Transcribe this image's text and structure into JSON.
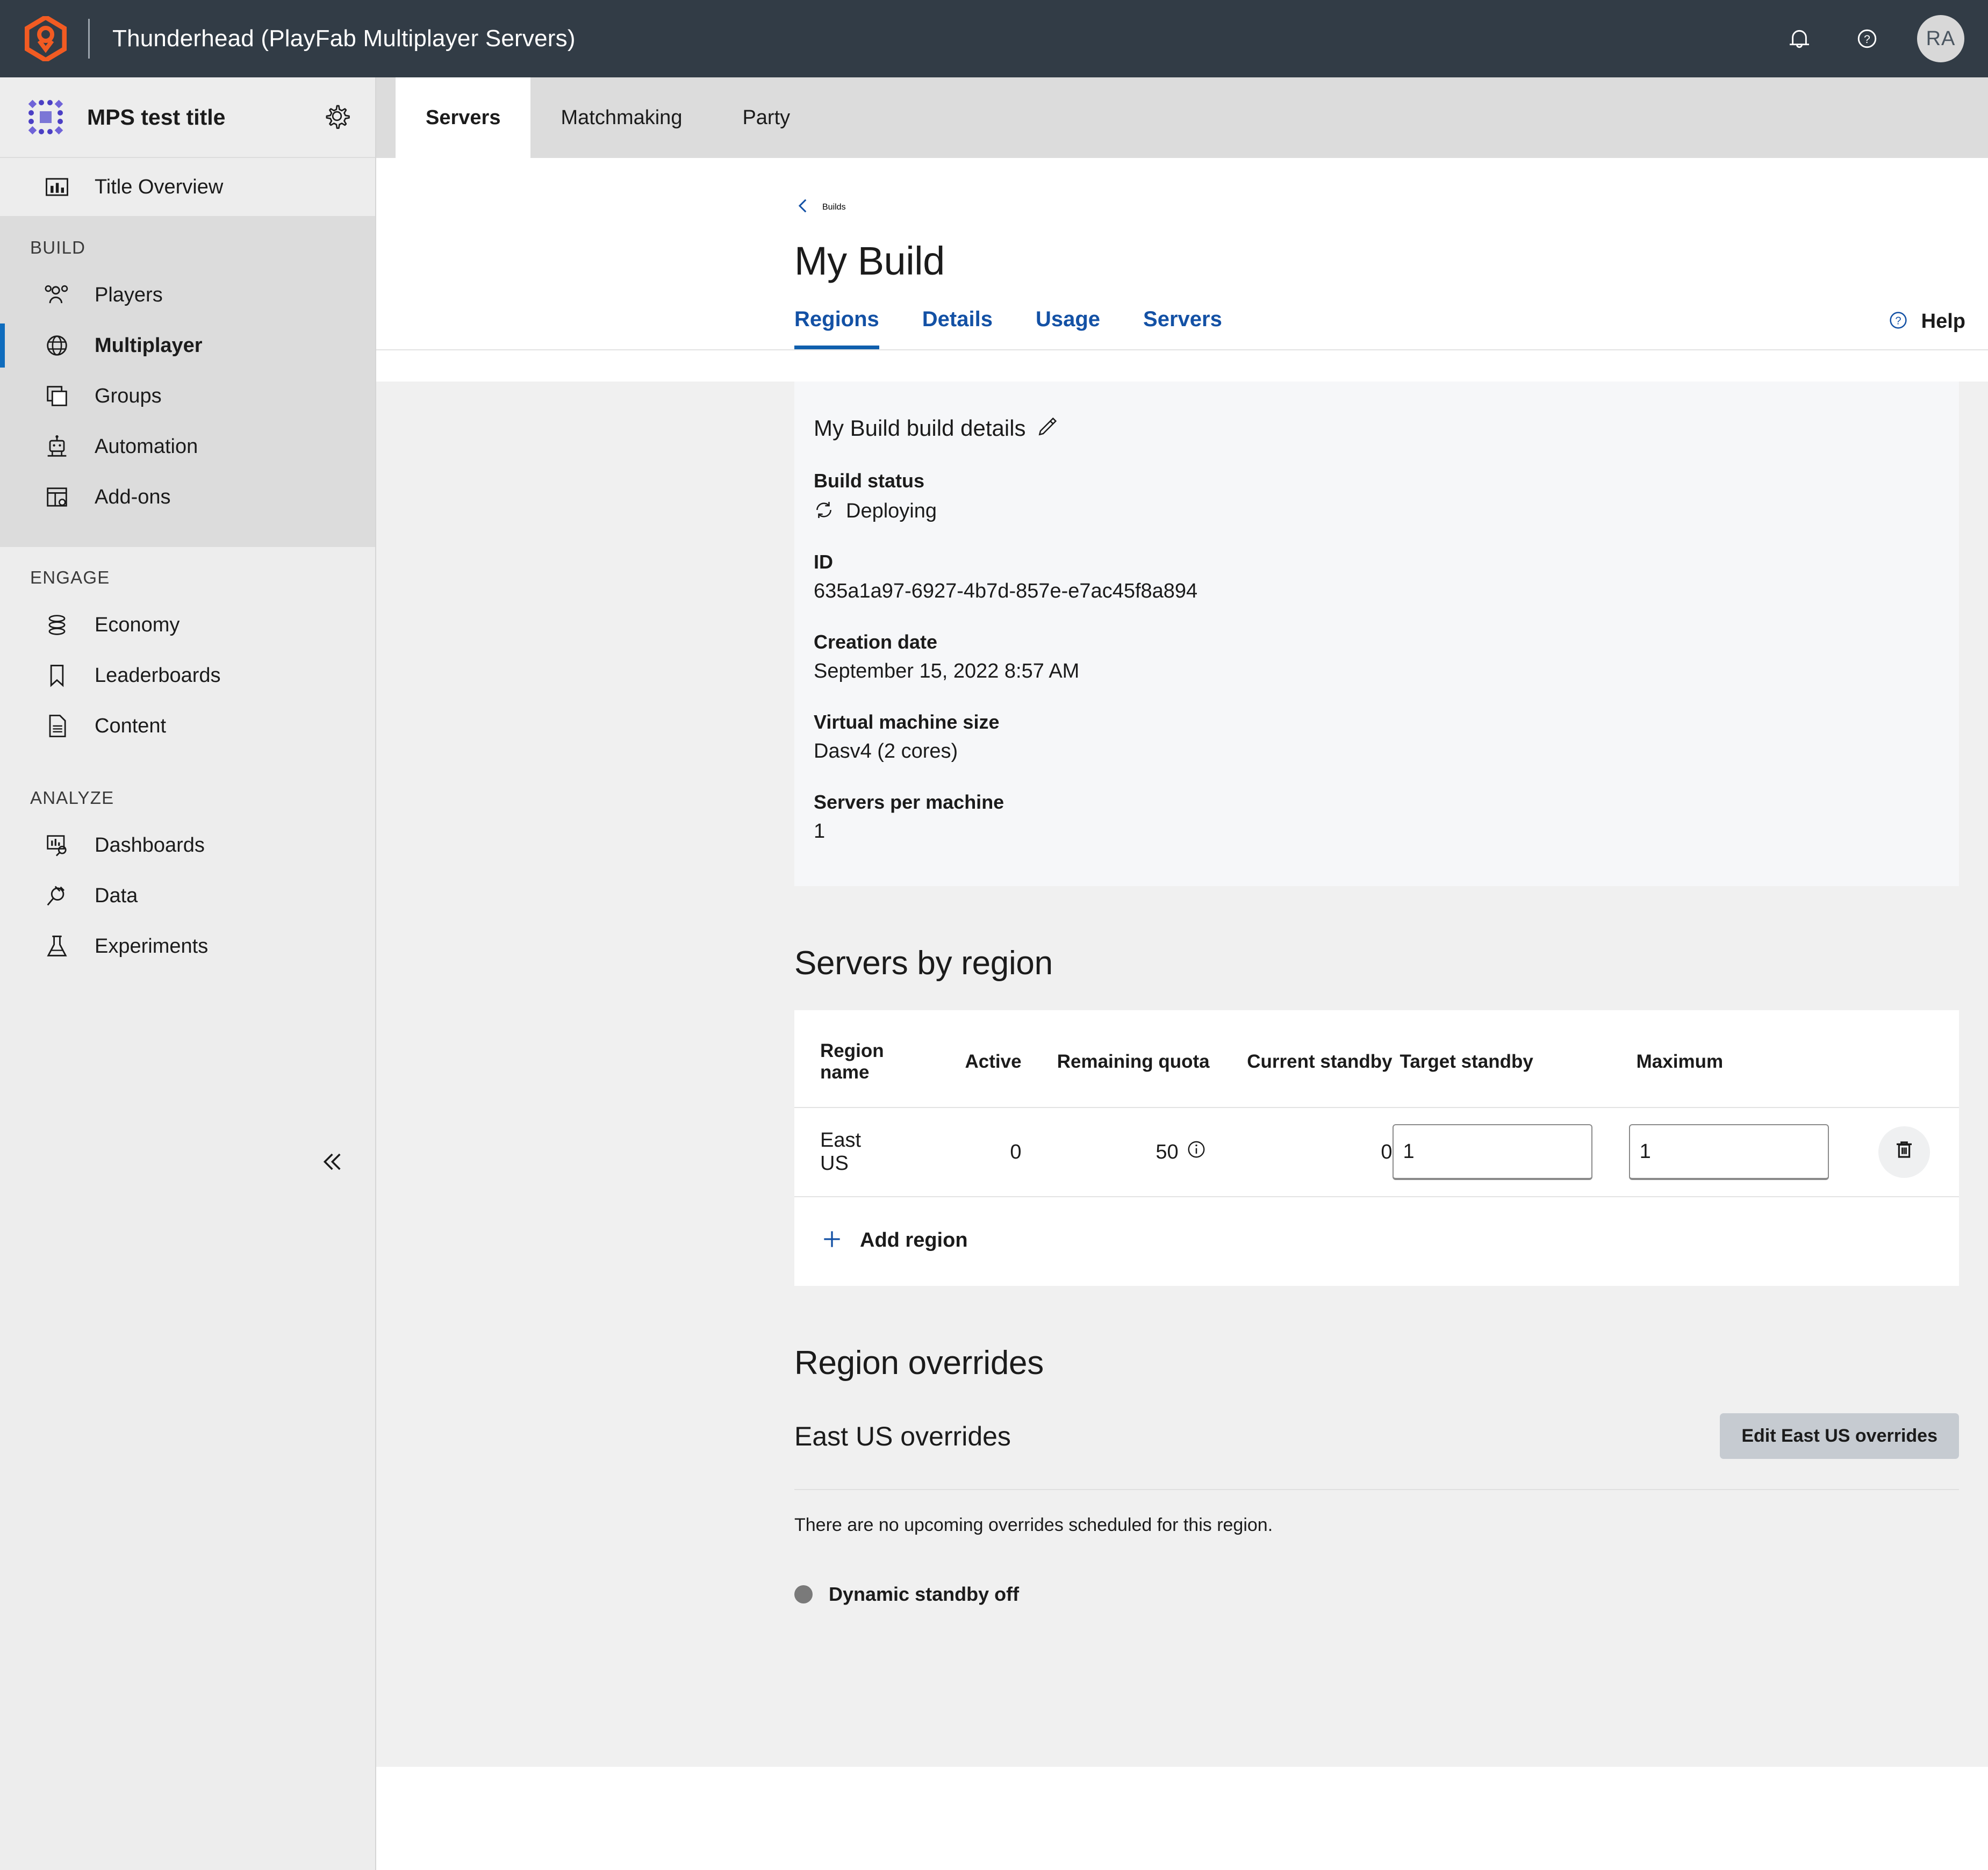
{
  "topbar": {
    "product_title": "Thunderhead (PlayFab Multiplayer Servers)",
    "logo_icon": "playfab-hex-logo",
    "notifications_icon": "bell-icon",
    "help_icon": "help-circle-icon",
    "avatar_initials": "RA",
    "background": "#323C46",
    "accent": "#F25B22"
  },
  "sidebar": {
    "title": "MPS test title",
    "title_logo_icon": "title-dots-square-icon",
    "settings_icon": "gear-icon",
    "overview": {
      "label": "Title Overview",
      "icon": "bar-chart-icon"
    },
    "groups": [
      {
        "heading": "BUILD",
        "items": [
          {
            "label": "Players",
            "icon": "people-icon",
            "active": false
          },
          {
            "label": "Multiplayer",
            "icon": "globe-icon",
            "active": true
          },
          {
            "label": "Groups",
            "icon": "stacked-squares-icon",
            "active": false
          },
          {
            "label": "Automation",
            "icon": "robot-icon",
            "active": false
          },
          {
            "label": "Add-ons",
            "icon": "table-gear-icon",
            "active": false
          }
        ]
      },
      {
        "heading": "ENGAGE",
        "items": [
          {
            "label": "Economy",
            "icon": "coins-stack-icon",
            "active": false
          },
          {
            "label": "Leaderboards",
            "icon": "bookmark-icon",
            "active": false
          },
          {
            "label": "Content",
            "icon": "document-icon",
            "active": false
          }
        ]
      },
      {
        "heading": "ANALYZE",
        "items": [
          {
            "label": "Dashboards",
            "icon": "dashboard-search-icon",
            "active": false
          },
          {
            "label": "Data",
            "icon": "plug-icon",
            "active": false
          },
          {
            "label": "Experiments",
            "icon": "flask-icon",
            "active": false
          }
        ]
      }
    ],
    "collapse_icon": "double-chevron-left-icon",
    "active_accent": "#0F6CBD"
  },
  "tabs": [
    {
      "label": "Servers",
      "active": true
    },
    {
      "label": "Matchmaking",
      "active": false
    },
    {
      "label": "Party",
      "active": false
    }
  ],
  "breadcrumb": {
    "label": "Builds",
    "icon": "chevron-left-icon",
    "color": "#1351A5"
  },
  "page": {
    "title": "My Build"
  },
  "subtabs": [
    {
      "label": "Regions",
      "active": true
    },
    {
      "label": "Details",
      "active": false
    },
    {
      "label": "Usage",
      "active": false
    },
    {
      "label": "Servers",
      "active": false
    }
  ],
  "help": {
    "label": "Help",
    "icon": "help-circle-icon"
  },
  "details": {
    "title": "My Build build details",
    "edit_icon": "pencil-icon",
    "fields": [
      {
        "label": "Build status",
        "value": "Deploying",
        "icon": "refresh-icon"
      },
      {
        "label": "ID",
        "value": "635a1a97-6927-4b7d-857e-e7ac45f8a894"
      },
      {
        "label": "Creation date",
        "value": "September 15, 2022 8:57 AM"
      },
      {
        "label": "Virtual machine size",
        "value": "Dasv4 (2 cores)"
      },
      {
        "label": "Servers per machine",
        "value": "1"
      }
    ]
  },
  "servers_by_region": {
    "section_title": "Servers by region",
    "columns": [
      "Region name",
      "Active",
      "Remaining quota",
      "Current standby",
      "Target standby",
      "Maximum"
    ],
    "rows": [
      {
        "region_name": "East US",
        "active": "0",
        "remaining_quota": "50",
        "quota_info_icon": "info-circle-icon",
        "current_standby": "0",
        "target_standby": "1",
        "maximum": "1",
        "delete_icon": "trash-icon"
      }
    ],
    "add_region": {
      "label": "Add region",
      "icon": "plus-icon"
    }
  },
  "region_overrides": {
    "section_title": "Region overrides",
    "subsection_title": "East US overrides",
    "edit_button": "Edit East US overrides",
    "note": "There are no upcoming overrides scheduled for this region.",
    "status": {
      "label": "Dynamic standby off",
      "dot_color": "#7a7a7a"
    }
  }
}
